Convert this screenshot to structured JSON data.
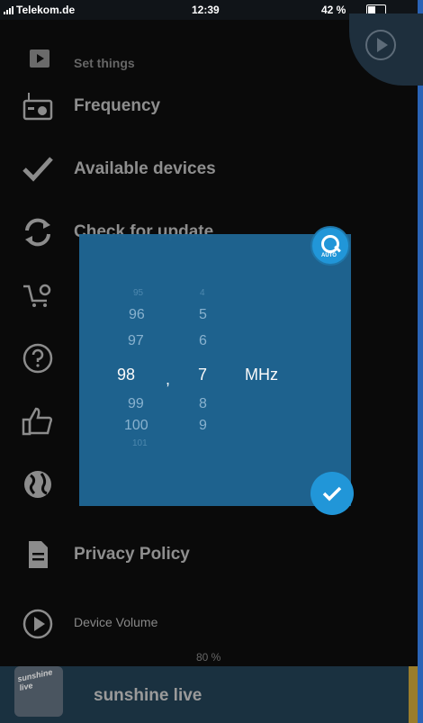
{
  "status": {
    "carrier": "Telekom.de",
    "time": "12:39",
    "battery": "42 %"
  },
  "menu": {
    "set_things": "Set things",
    "frequency": "Frequency",
    "devices": "Available devices",
    "update": "Check for update",
    "privacy": "Privacy Policy",
    "volume": "Device Volume"
  },
  "volume_percent": "80 %",
  "player": {
    "station": "sunshine live",
    "logo_text": "sunshine live"
  },
  "dialog": {
    "int_above_faint": "95",
    "int_above_2": "96",
    "int_above_1": "97",
    "int_selected": "98",
    "int_below_1": "99",
    "int_below_2": "100",
    "int_below_faint": "101",
    "separator": ",",
    "dec_above_faint": "4",
    "dec_above_2": "5",
    "dec_above_1": "6",
    "dec_selected": "7",
    "dec_below_1": "8",
    "dec_below_2": "9",
    "unit": "MHz",
    "auto_label": "AUTO"
  },
  "icons": {
    "set_things": "play-square-icon",
    "frequency": "radio-icon",
    "devices": "checkmark-icon",
    "update": "refresh-icon",
    "shop": "cart-icon",
    "help": "help-circle-icon",
    "like": "thumbs-up-icon",
    "web": "globe-icon",
    "privacy": "document-icon",
    "volume": "play-circle-icon"
  },
  "colors": {
    "dialog_bg": "#1f6491",
    "accent": "#2196d8"
  }
}
